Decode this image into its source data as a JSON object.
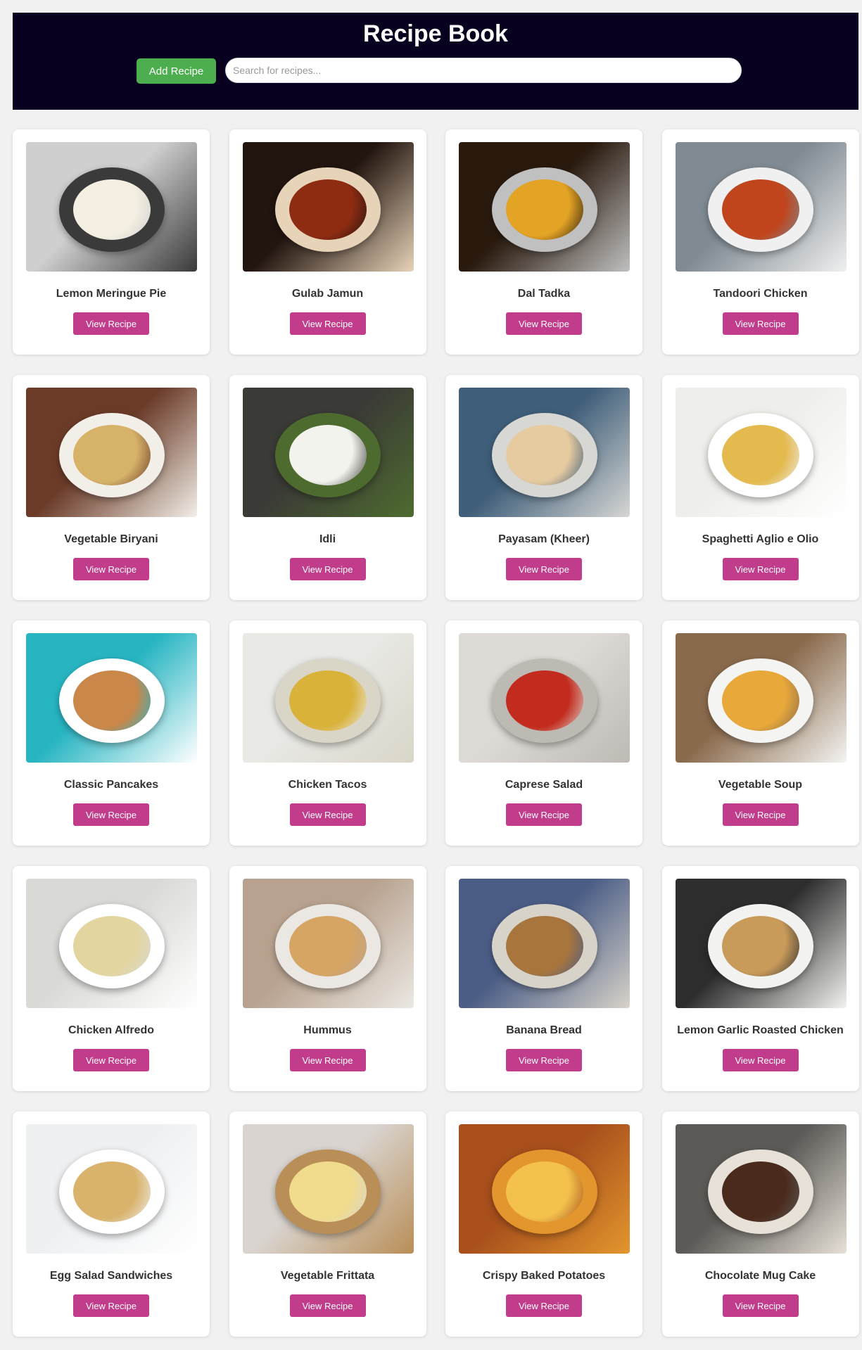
{
  "header": {
    "title": "Recipe Book",
    "add_button_label": "Add Recipe",
    "search_placeholder": "Search for recipes...",
    "search_value": "",
    "colors": {
      "background": "#08001e",
      "add_button": "#4cae4f"
    }
  },
  "view_button_label": "View Recipe",
  "view_button_color": "#c13d8b",
  "recipes": [
    {
      "title": "Lemon Meringue Pie",
      "image": "lemon-meringue-pie-photo",
      "colors": [
        "#cfcfcf",
        "#3a3a3a",
        "#f4efe2"
      ]
    },
    {
      "title": "Gulab Jamun",
      "image": "gulab-jamun-photo",
      "colors": [
        "#22140f",
        "#e7d3b8",
        "#8e2c12"
      ]
    },
    {
      "title": "Dal Tadka",
      "image": "dal-tadka-photo",
      "colors": [
        "#2a1a0e",
        "#c0c0c0",
        "#e3a324"
      ]
    },
    {
      "title": "Tandoori Chicken",
      "image": "tandoori-chicken-photo",
      "colors": [
        "#7f8a92",
        "#f0f0f0",
        "#c0451c"
      ]
    },
    {
      "title": "Vegetable Biryani",
      "image": "vegetable-biryani-photo",
      "colors": [
        "#6b3b28",
        "#f2efe8",
        "#d7b36a"
      ]
    },
    {
      "title": "Idli",
      "image": "idli-photo",
      "colors": [
        "#3a3a36",
        "#4e6b2f",
        "#f3f3ee"
      ]
    },
    {
      "title": "Payasam (Kheer)",
      "image": "payasam-kheer-photo",
      "colors": [
        "#3f5e7a",
        "#d7d7d4",
        "#e7cba0"
      ]
    },
    {
      "title": "Spaghetti Aglio e Olio",
      "image": "spaghetti-aglio-e-olio-photo",
      "colors": [
        "#eeeeea",
        "#ffffff",
        "#e4b94d"
      ]
    },
    {
      "title": "Classic Pancakes",
      "image": "classic-pancakes-photo",
      "colors": [
        "#27b5c2",
        "#ffffff",
        "#c9874a"
      ]
    },
    {
      "title": "Chicken Tacos",
      "image": "chicken-tacos-photo",
      "colors": [
        "#e9e9e6",
        "#d9d6c8",
        "#d9b23a"
      ]
    },
    {
      "title": "Caprese Salad",
      "image": "caprese-salad-photo",
      "colors": [
        "#dedbd7",
        "#bdbab4",
        "#c22b1d"
      ]
    },
    {
      "title": "Vegetable Soup",
      "image": "vegetable-soup-photo",
      "colors": [
        "#8a6a4c",
        "#f4f4f2",
        "#e9a93a"
      ]
    },
    {
      "title": "Chicken Alfredo",
      "image": "chicken-alfredo-photo",
      "colors": [
        "#d9d9d6",
        "#ffffff",
        "#e3d5a0"
      ]
    },
    {
      "title": "Hummus",
      "image": "hummus-photo",
      "colors": [
        "#b8a28f",
        "#ebe8e3",
        "#d7a563"
      ]
    },
    {
      "title": "Banana Bread",
      "image": "banana-bread-photo",
      "colors": [
        "#4b5d86",
        "#d8d3c9",
        "#a8753d"
      ]
    },
    {
      "title": "Lemon Garlic Roasted Chicken",
      "image": "lemon-garlic-roasted-chicken-photo",
      "colors": [
        "#2d2d2d",
        "#f2f2f0",
        "#c99b5a"
      ]
    },
    {
      "title": "Egg Salad Sandwiches",
      "image": "egg-salad-sandwiches-photo",
      "colors": [
        "#eef0f2",
        "#ffffff",
        "#d9b36b"
      ]
    },
    {
      "title": "Vegetable Frittata",
      "image": "vegetable-frittata-photo",
      "colors": [
        "#d9d4cf",
        "#b98e57",
        "#f0dc8c"
      ]
    },
    {
      "title": "Crispy Baked Potatoes",
      "image": "crispy-baked-potatoes-photo",
      "colors": [
        "#a84f1c",
        "#e3962d",
        "#f3c14c"
      ]
    },
    {
      "title": "Chocolate Mug Cake",
      "image": "chocolate-mug-cake-photo",
      "colors": [
        "#5c5a57",
        "#e7e1d7",
        "#4a2a1c"
      ]
    }
  ]
}
